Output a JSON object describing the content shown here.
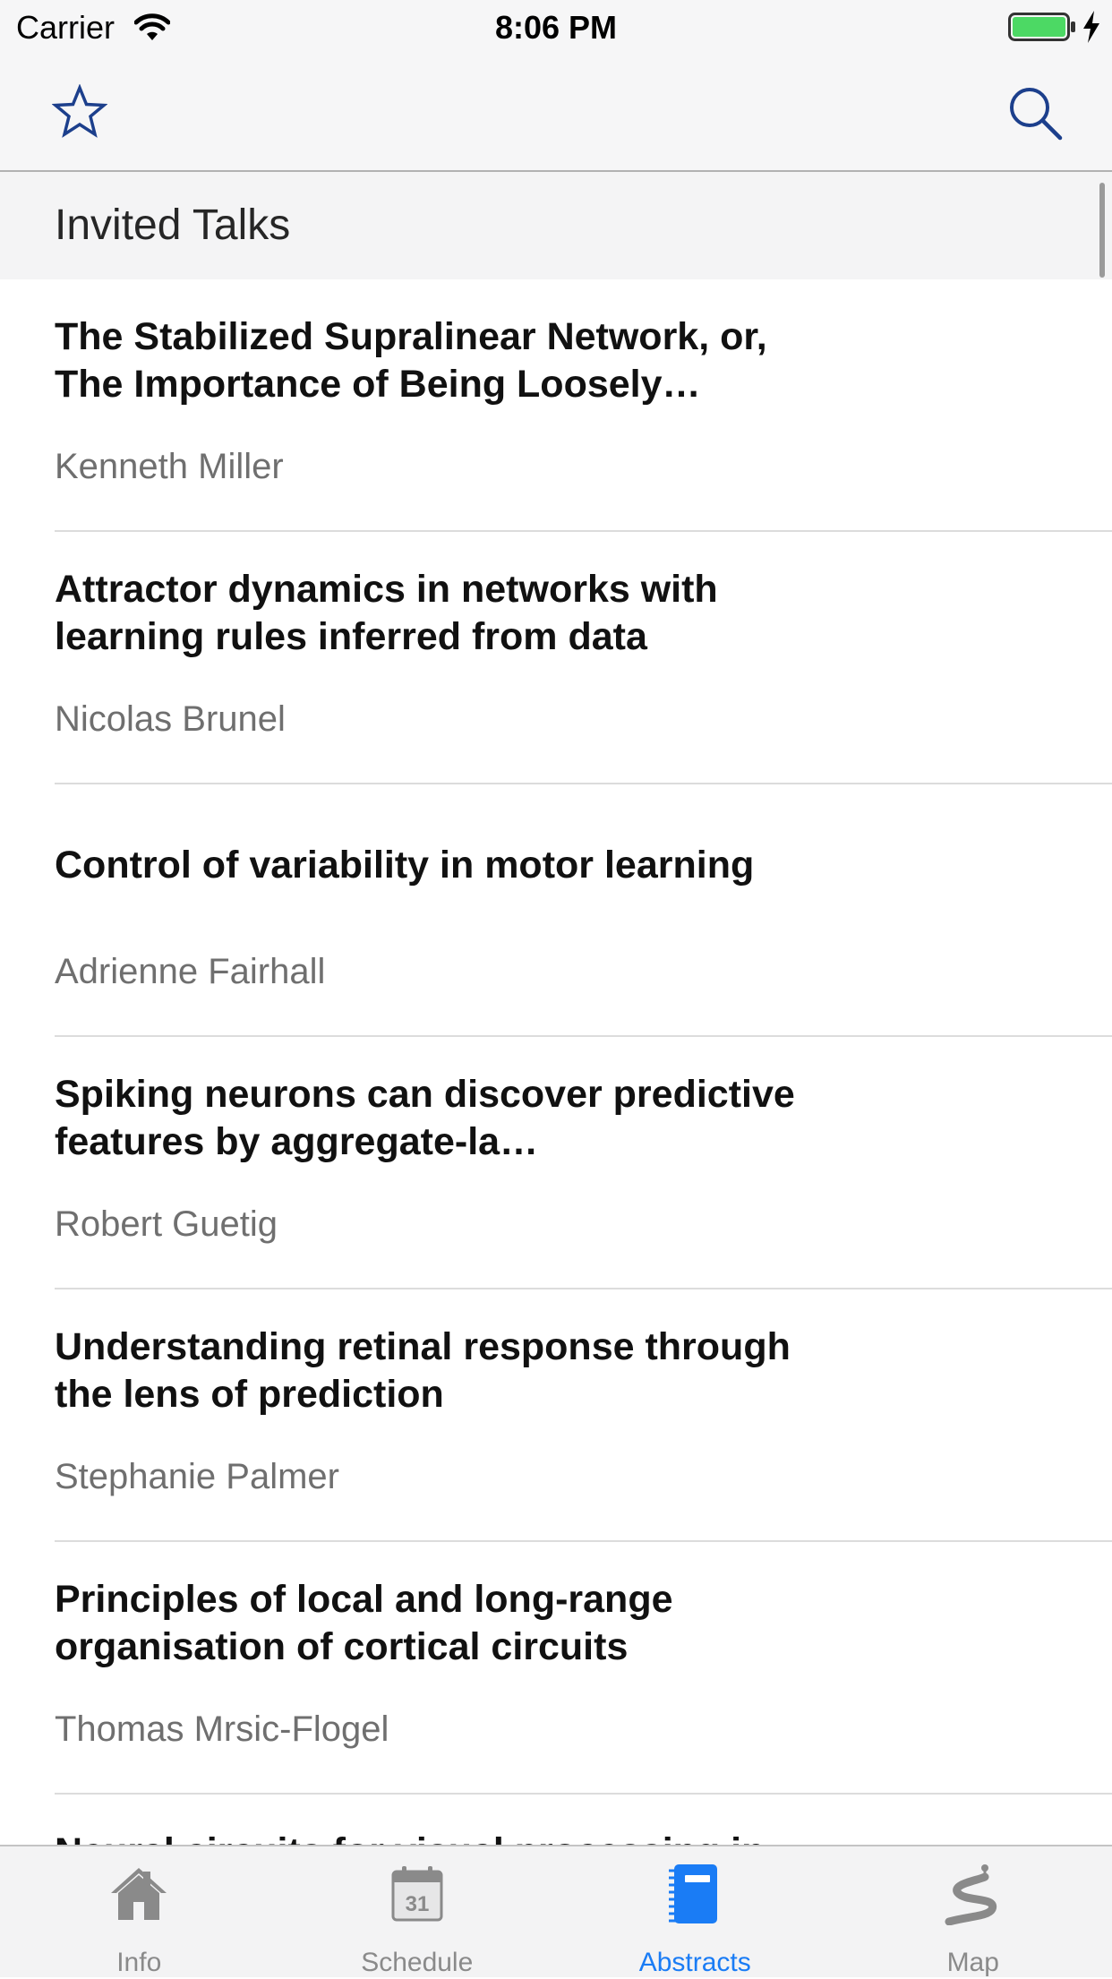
{
  "status_bar": {
    "carrier": "Carrier",
    "time": "8:06 PM",
    "battery_color": "#4cd964"
  },
  "nav_bar": {
    "left_icon": "star-outline-icon",
    "right_icon": "search-icon",
    "icon_color": "#1c3f8c"
  },
  "section": {
    "title": "Invited Talks"
  },
  "talks": [
    {
      "title": "The Stabilized Supralinear Network, or, The Importance of Being Loosely…",
      "author": "Kenneth Miller"
    },
    {
      "title": "Attractor dynamics in networks with learning rules inferred from data",
      "author": "Nicolas Brunel"
    },
    {
      "title": "Control of variability in motor learning",
      "author": "Adrienne Fairhall"
    },
    {
      "title": "Spiking neurons can discover predictive features by aggregate-la…",
      "author": "Robert Guetig"
    },
    {
      "title": "Understanding retinal response through the lens of prediction",
      "author": "Stephanie Palmer"
    },
    {
      "title": "Principles of local and long-range organisation of cortical circuits",
      "author": "Thomas Mrsic-Flogel"
    },
    {
      "title": "Neural circuits for visual processing in",
      "author": ""
    }
  ],
  "tab_bar": {
    "tabs": [
      {
        "label": "Info",
        "icon": "home-icon",
        "active": false
      },
      {
        "label": "Schedule",
        "icon": "calendar-icon",
        "icon_text": "31",
        "active": false
      },
      {
        "label": "Abstracts",
        "icon": "notebook-icon",
        "active": true
      },
      {
        "label": "Map",
        "icon": "map-route-icon",
        "active": false
      }
    ],
    "active_color": "#1a7cf5",
    "inactive_color": "#8a8a8a"
  }
}
